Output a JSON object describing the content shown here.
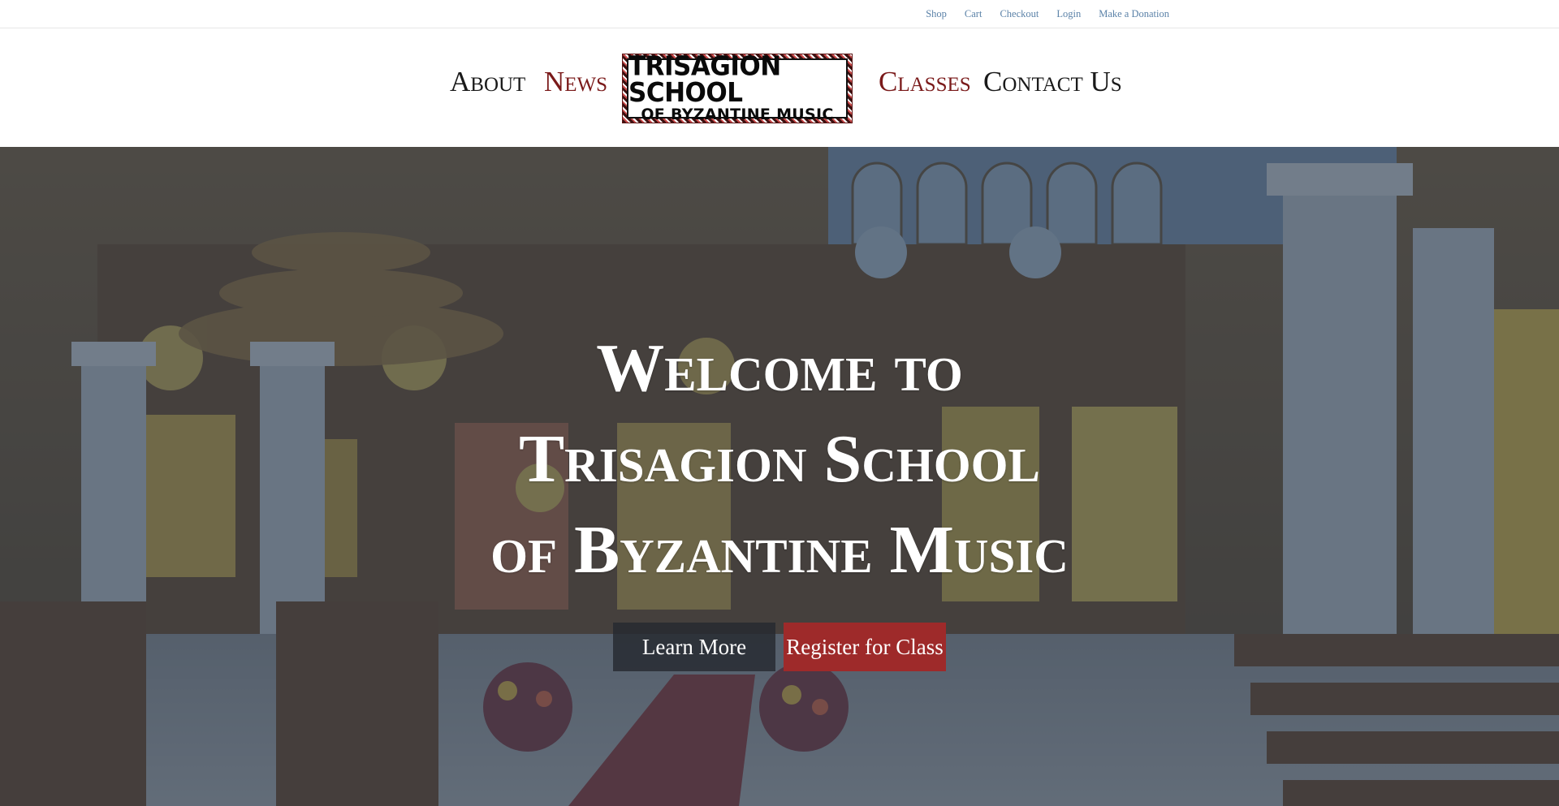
{
  "utility_nav": {
    "items": [
      {
        "label": "Shop"
      },
      {
        "label": "Cart"
      },
      {
        "label": "Checkout"
      },
      {
        "label": "Login"
      },
      {
        "label": "Make a Donation"
      }
    ]
  },
  "main_nav": {
    "about": "About",
    "news": "News",
    "classes": "Classes",
    "contact": "Contact Us"
  },
  "logo": {
    "line1": "TRISAGION SCHOOL",
    "line2": "OF BYZANTINE MUSIC"
  },
  "hero": {
    "title_lines": [
      "Welcome to",
      "Trisagion School",
      "of Byzantine Music"
    ],
    "learn_more_label": "Learn More",
    "register_label": "Register for Class"
  },
  "colors": {
    "link_blue": "#5b82a8",
    "nav_red": "#7a1a1a",
    "button_red": "#9e2a2a",
    "overlay": "#344252"
  }
}
